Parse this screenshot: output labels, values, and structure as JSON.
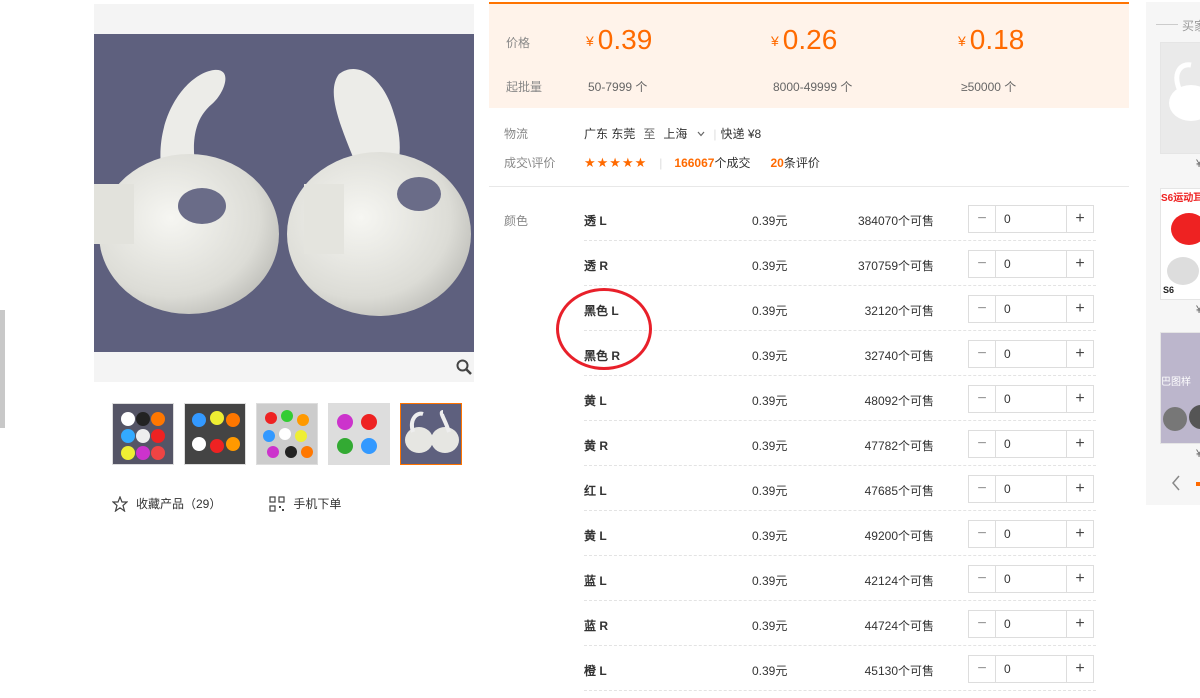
{
  "price_panel": {
    "price_label": "价格",
    "moq_label": "起批量",
    "tiers": [
      {
        "currency": "¥",
        "price": "0.39",
        "range": "50-7999 个"
      },
      {
        "currency": "¥",
        "price": "0.26",
        "range": "8000-49999 个"
      },
      {
        "currency": "¥",
        "price": "0.18",
        "range": "≥50000 个"
      }
    ]
  },
  "logistics": {
    "label": "物流",
    "origin": "广东 东莞",
    "to": "至",
    "destination": "上海",
    "shipping": "快递 ¥8"
  },
  "deals": {
    "label": "成交\\评价",
    "stars": "★★★★★",
    "deal_count": "166067",
    "deal_suffix": "个成交",
    "review_count": "20",
    "review_suffix": "条评价"
  },
  "color_label": "颜色",
  "skus": [
    {
      "name": "透 L",
      "price": "0.39元",
      "stock": "384070个可售",
      "qty": "0"
    },
    {
      "name": "透 R",
      "price": "0.39元",
      "stock": "370759个可售",
      "qty": "0"
    },
    {
      "name": "黑色 L",
      "price": "0.39元",
      "stock": "32120个可售",
      "qty": "0"
    },
    {
      "name": "黑色 R",
      "price": "0.39元",
      "stock": "32740个可售",
      "qty": "0"
    },
    {
      "name": "黄 L",
      "price": "0.39元",
      "stock": "48092个可售",
      "qty": "0"
    },
    {
      "name": "黄 R",
      "price": "0.39元",
      "stock": "47782个可售",
      "qty": "0"
    },
    {
      "name": "红 L",
      "price": "0.39元",
      "stock": "47685个可售",
      "qty": "0"
    },
    {
      "name": "黄 L",
      "price": "0.39元",
      "stock": "49200个可售",
      "qty": "0"
    },
    {
      "name": "蓝 L",
      "price": "0.39元",
      "stock": "42124个可售",
      "qty": "0"
    },
    {
      "name": "蓝 R",
      "price": "0.39元",
      "stock": "44724个可售",
      "qty": "0"
    },
    {
      "name": "橙 L",
      "price": "0.39元",
      "stock": "45130个可售",
      "qty": "0"
    }
  ],
  "stepper": {
    "minus": "−",
    "plus": "+"
  },
  "gallery": {
    "favorite_label": "收藏产品（29）",
    "mobile_order_label": "手机下单"
  },
  "side_panel": {
    "title": "买家",
    "yen": "¥",
    "promo_text": "S6运动耳",
    "promo_text2": "S6",
    "promo_text3": "巴图样"
  },
  "icons": {
    "zoom": "magnifier-icon",
    "favorite": "star-outline-icon",
    "qr": "qr-code-icon",
    "dropdown": "chevron-down-icon",
    "prev": "chevron-left-icon"
  },
  "colors": {
    "accent": "#ff6a00",
    "price_bg": "#fff3ea",
    "annotation": "#e8202a"
  }
}
